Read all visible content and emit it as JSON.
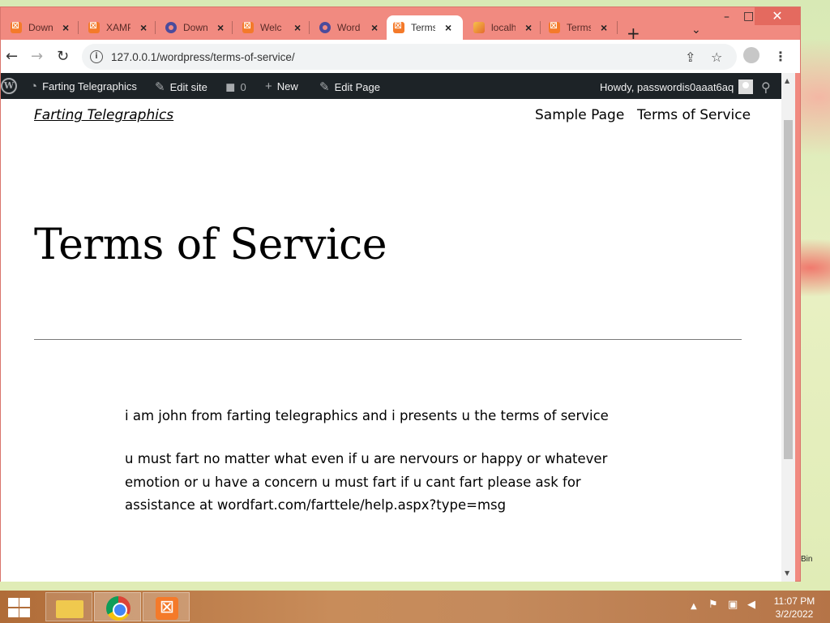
{
  "browser": {
    "tabs": [
      {
        "label": "Down",
        "icon": "xampp-icon"
      },
      {
        "label": "XAMP",
        "icon": "xampp-icon"
      },
      {
        "label": "Down",
        "icon": "hex-icon"
      },
      {
        "label": "Welc",
        "icon": "xampp-icon"
      },
      {
        "label": "Word",
        "icon": "hex-icon"
      },
      {
        "label": "Terms",
        "icon": "xampp-icon",
        "active": true
      },
      {
        "label": "localh",
        "icon": "phpmyadmin-icon"
      },
      {
        "label": "Terms",
        "icon": "xampp-icon"
      }
    ],
    "new_tab": "+",
    "tab_search": "⌄",
    "minimize": "–",
    "maximize": "□",
    "close": "✕",
    "url": "127.0.0.1/wordpress/terms-of-service/"
  },
  "adminbar": {
    "site_name": "Farting Telegraphics",
    "edit_site": "Edit site",
    "comments_count": "0",
    "new_label": "New",
    "edit_page": "Edit Page",
    "howdy": "Howdy, passwordis0aaat6aq"
  },
  "site": {
    "title": "Farting Telegraphics",
    "nav": [
      "Sample Page",
      "Terms of Service"
    ]
  },
  "page": {
    "heading": "Terms of Service",
    "paragraph1": "i am john from farting telegraphics and i presents u the terms of service",
    "paragraph2": "u must fart no matter what even if u are nervours or happy or whatever emotion or u have a concern u must fart if u cant fart please ask for assistance at wordfart.com/farttele/help.aspx?type=msg"
  },
  "desktop": {
    "recycle_bin": "Bin"
  },
  "taskbar": {
    "time": "11:07 PM",
    "date": "3/2/2022"
  },
  "colors": {
    "window_frame": "#f18a80",
    "adminbar_bg": "#1d2327"
  }
}
